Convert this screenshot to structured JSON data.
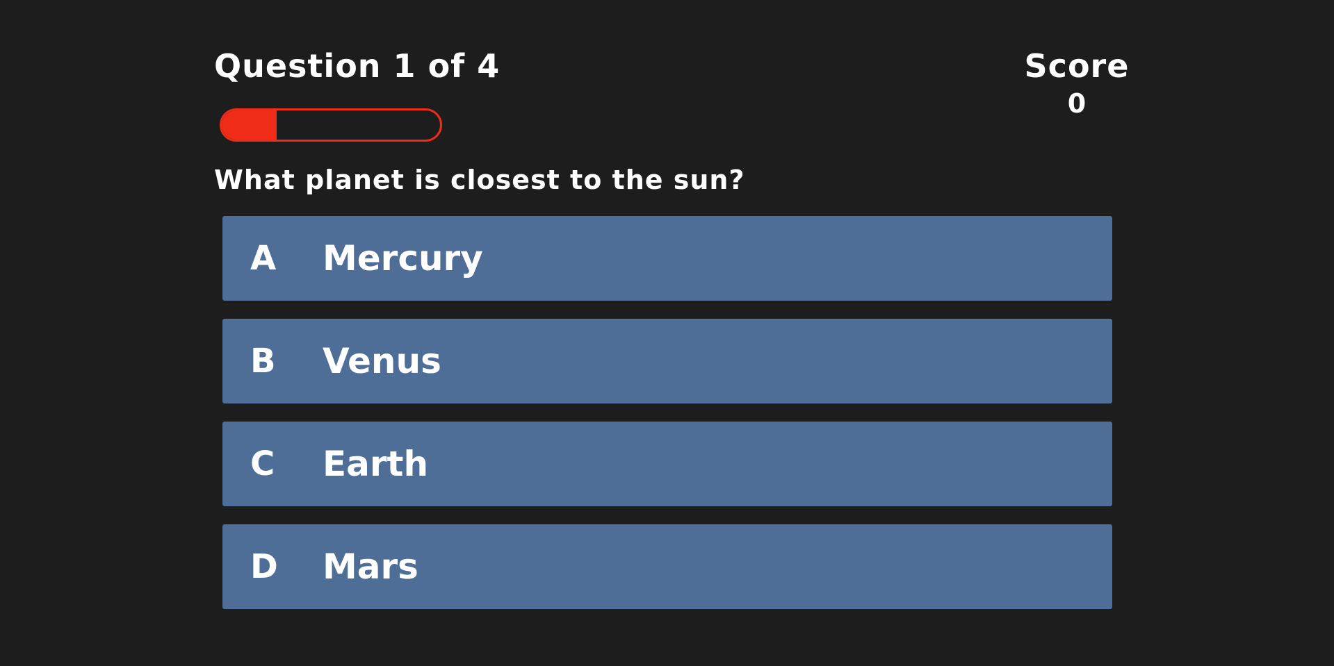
{
  "header": {
    "question_counter": "Question 1 of 4",
    "score_label": "Score",
    "score_value": "0"
  },
  "progress": {
    "fraction": 0.25,
    "color": "#ee2c17"
  },
  "question": {
    "text": "What planet is closest to the sun?"
  },
  "answers": [
    {
      "letter": "A",
      "text": "Mercury"
    },
    {
      "letter": "B",
      "text": "Venus"
    },
    {
      "letter": "C",
      "text": "Earth"
    },
    {
      "letter": "D",
      "text": "Mars"
    }
  ],
  "colors": {
    "background": "#1d1d1e",
    "answer_background": "#4e6e98",
    "text": "#ffffff"
  }
}
